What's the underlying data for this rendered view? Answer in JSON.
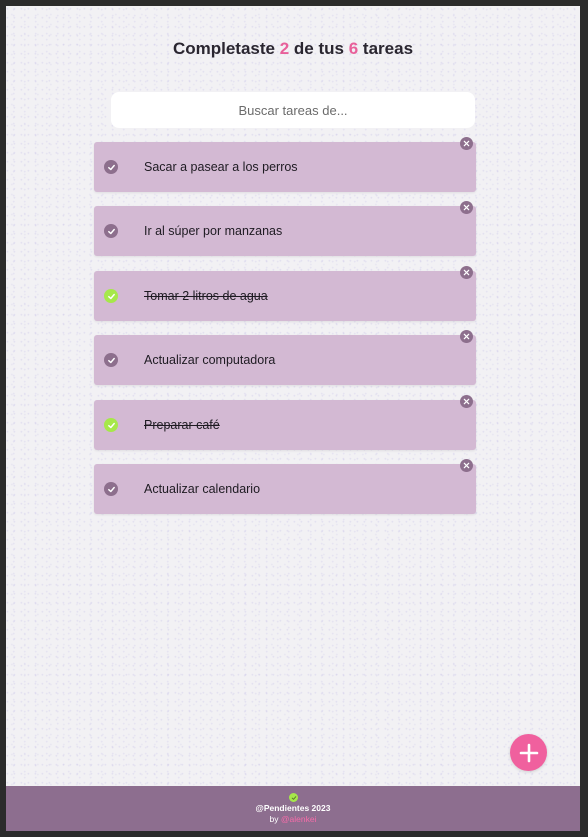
{
  "header": {
    "prefix": "Completaste",
    "completed": "2",
    "middle": "de tus",
    "total": "6",
    "suffix": "tareas"
  },
  "search": {
    "placeholder": "Buscar tareas de...",
    "value": ""
  },
  "todos": [
    {
      "text": "Sacar a pasear a los perros",
      "completed": false
    },
    {
      "text": "Ir al súper por manzanas",
      "completed": false
    },
    {
      "text": "Tomar 2 litros de agua",
      "completed": true
    },
    {
      "text": "Actualizar computadora",
      "completed": false
    },
    {
      "text": "Preparar café",
      "completed": true
    },
    {
      "text": "Actualizar calendario",
      "completed": false
    }
  ],
  "add_button": {
    "icon": "plus-icon"
  },
  "footer": {
    "brand": "@Pendientes 2023",
    "by_label": "by",
    "author": "@alenkei"
  },
  "colors": {
    "accent": "#f0609e",
    "item_background": "#d3b9d3",
    "check_pending": "#8d6f8d",
    "check_done": "#a6e84a",
    "footer_background": "#8d6e8f"
  }
}
